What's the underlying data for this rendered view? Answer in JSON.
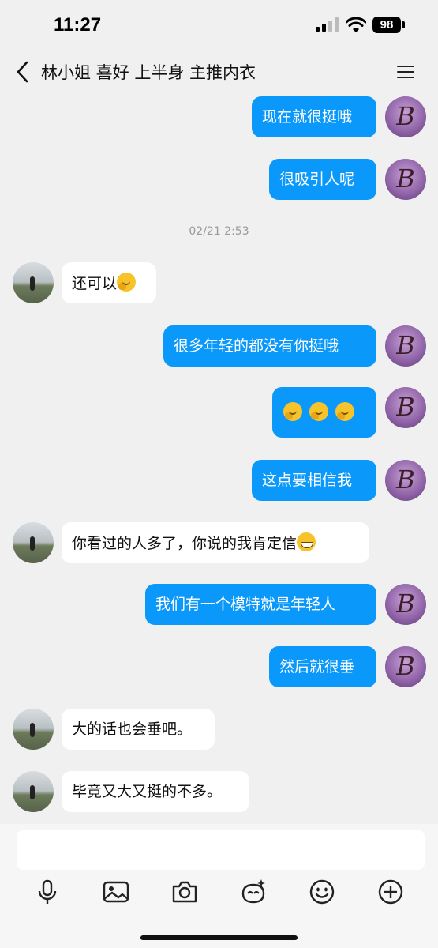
{
  "status_bar": {
    "time": "11:27",
    "battery": "98"
  },
  "header": {
    "title": "林小姐 喜好 上半身 主推内衣"
  },
  "avatars": {
    "mine_letter": "B"
  },
  "messages": [
    {
      "from": "me",
      "text": "现在就很挺哦"
    },
    {
      "from": "me",
      "text": "很吸引人呢"
    },
    {
      "type": "timestamp",
      "text": "02/21 2:53"
    },
    {
      "from": "them",
      "text": "还可以",
      "emoji": "face-with-hand-over-mouth"
    },
    {
      "from": "me",
      "text": "很多年轻的都没有你挺哦"
    },
    {
      "from": "me",
      "text": "",
      "emoji": "face-with-hand-over-mouth ×3"
    },
    {
      "from": "me",
      "text": "这点要相信我"
    },
    {
      "from": "them",
      "text": "你看过的人多了，你说的我肯定信",
      "emoji": "grinning-face"
    },
    {
      "from": "me",
      "text": "我们有一个模特就是年轻人"
    },
    {
      "from": "me",
      "text": "然后就很垂"
    },
    {
      "from": "them",
      "text": "大的话也会垂吧。"
    },
    {
      "from": "them",
      "text": "毕竟又大又挺的不多。"
    }
  ],
  "composer": {
    "input_value": "",
    "input_placeholder": ""
  },
  "toolbar": [
    "microphone-icon",
    "image-icon",
    "camera-icon",
    "ai-sparkle-icon",
    "emoji-icon",
    "plus-icon"
  ],
  "colors": {
    "outgoing_bubble": "#0a99fb",
    "incoming_bubble": "#ffffff",
    "background": "#f0f0f0"
  }
}
